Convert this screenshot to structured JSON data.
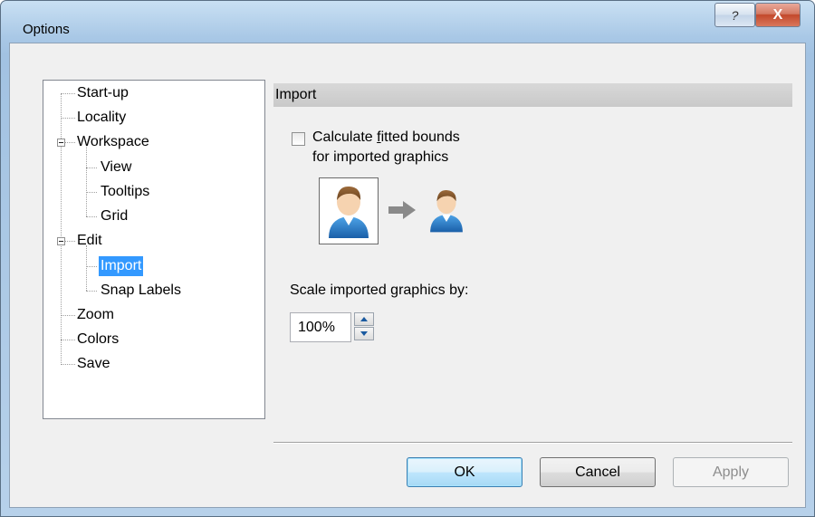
{
  "window": {
    "title": "Options",
    "help_label": "?",
    "close_label": "X"
  },
  "tree": {
    "items": [
      {
        "label": "Start-up"
      },
      {
        "label": "Locality"
      },
      {
        "label": "Workspace"
      },
      {
        "label": "View"
      },
      {
        "label": "Tooltips"
      },
      {
        "label": "Grid"
      },
      {
        "label": "Edit"
      },
      {
        "label": "Import"
      },
      {
        "label": "Snap Labels"
      },
      {
        "label": "Zoom"
      },
      {
        "label": "Colors"
      },
      {
        "label": "Save"
      }
    ],
    "selected": "Import"
  },
  "panel": {
    "header": "Import",
    "checkbox": {
      "label_before": "Calculate ",
      "label_accel": "f",
      "label_after": "itted bounds",
      "label_line2": "for imported graphics",
      "checked": false
    },
    "scale_label": "Scale imported graphics by:",
    "scale_value": "100%"
  },
  "buttons": {
    "ok": "OK",
    "cancel": "Cancel",
    "apply": "Apply"
  },
  "icons": {
    "user": "user-icon",
    "arrow": "arrow-right-icon"
  },
  "colors": {
    "selection": "#3399ff",
    "header_bg": "#d0d0d0"
  }
}
